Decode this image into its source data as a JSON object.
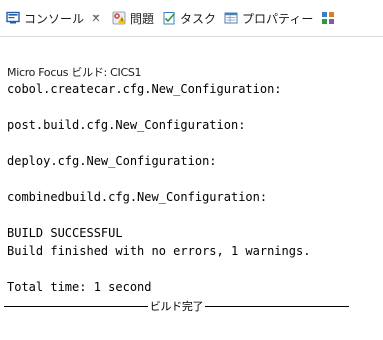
{
  "tabs": [
    {
      "label": "コンソール",
      "icon": "console-icon",
      "active": true
    },
    {
      "label": "問題",
      "icon": "problems-icon",
      "active": false
    },
    {
      "label": "タスク",
      "icon": "tasks-icon",
      "active": false
    },
    {
      "label": "プロパティー",
      "icon": "properties-icon",
      "active": false
    },
    {
      "label": "",
      "icon": "progress-icon",
      "active": false
    }
  ],
  "console": {
    "title": "Micro Focus ビルド: CICS1",
    "lines": [
      "cobol.createcar.cfg.New_Configuration:",
      "",
      "post.build.cfg.New_Configuration:",
      "",
      "deploy.cfg.New_Configuration:",
      "",
      "combinedbuild.cfg.New_Configuration:",
      "",
      "BUILD SUCCESSFUL",
      "Build finished with no errors, 1 warnings.",
      "",
      "Total time: 1 second"
    ],
    "done_label": "ビルド完了"
  },
  "colors": {
    "console_icon": "#1f5fa8",
    "problems_icon": "#c0392b",
    "tasks_icon": "#3a7fc4",
    "properties_icon": "#4a7fb5"
  }
}
